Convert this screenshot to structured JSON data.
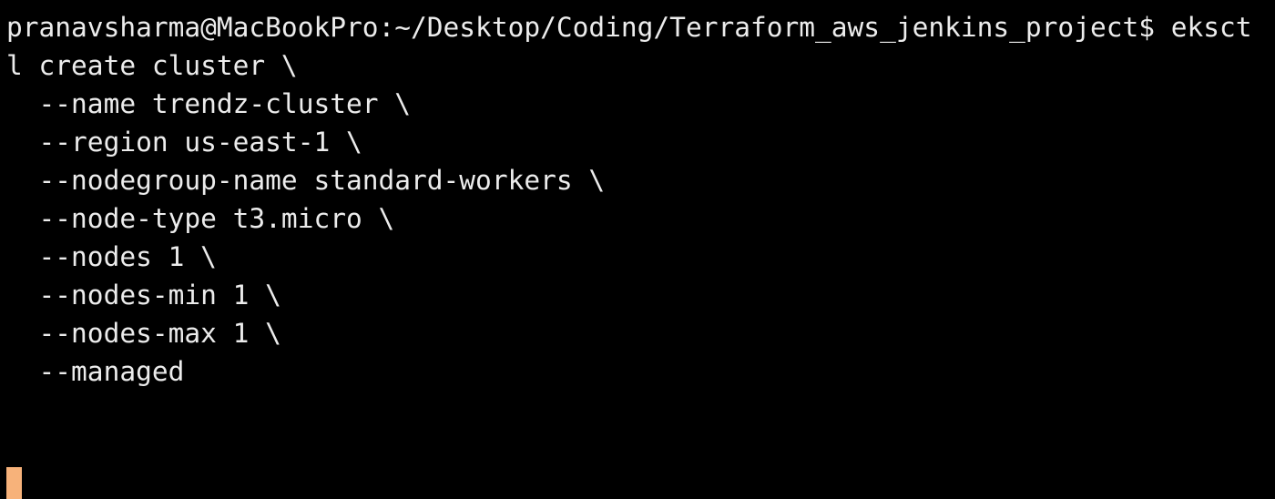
{
  "terminal": {
    "lines": [
      "pranavsharma@MacBookPro:~/Desktop/Coding/Terraform_aws_jenkins_project$ eksct",
      "l create cluster \\",
      "  --name trendz-cluster \\",
      "  --region us-east-1 \\",
      "  --nodegroup-name standard-workers \\",
      "  --node-type t3.micro \\",
      "  --nodes 1 \\",
      "  --nodes-min 1 \\",
      "  --nodes-max 1 \\",
      "  --managed"
    ],
    "colors": {
      "background": "#000000",
      "text": "#ececec",
      "cursor": "#f7b27a"
    }
  }
}
